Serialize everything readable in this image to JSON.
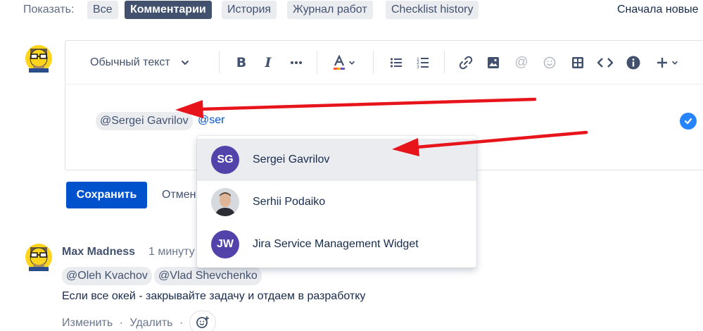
{
  "filter_bar": {
    "label": "Показать:",
    "tabs": [
      {
        "label": "Все",
        "active": false
      },
      {
        "label": "Комментарии",
        "active": true
      },
      {
        "label": "История",
        "active": false
      },
      {
        "label": "Журнал работ",
        "active": false
      },
      {
        "label": "Checklist history",
        "active": false
      }
    ],
    "sort": "Сначала новые"
  },
  "editor": {
    "text_style": "Обычный текст",
    "toolbar_icons": [
      "bold-icon",
      "italic-icon",
      "more-icon",
      "text-color-icon",
      "bullet-list-icon",
      "numbered-list-icon",
      "link-icon",
      "image-icon",
      "mention-icon",
      "emoji-icon",
      "table-icon",
      "code-icon",
      "info-icon",
      "insert-plus-icon"
    ],
    "mention_chip": "@Sergei Gavrilov",
    "mention_query": "@ser"
  },
  "buttons": {
    "save": "Сохранить",
    "cancel": "Отмен"
  },
  "mention_dropdown": {
    "items": [
      {
        "initials": "SG",
        "name": "Sergei Gavrilov",
        "selected": true,
        "avatar_color": "#5243aa"
      },
      {
        "initials": "",
        "name": "Serhii Podaiko",
        "selected": false,
        "avatar_color": "#8a8f98"
      },
      {
        "initials": "JW",
        "name": "Jira Service Management Widget",
        "selected": false,
        "avatar_color": "#5243aa"
      }
    ]
  },
  "comment": {
    "author": "Max Madness",
    "time": "1 минуту",
    "mentions": [
      "@Oleh Kvachov",
      "@Vlad Shevchenko"
    ],
    "text": "Если все окей - закрывайте задачу и отдаем в разработку",
    "actions": {
      "edit": "Изменить",
      "separator": "·",
      "delete": "Удалить"
    }
  },
  "colors": {
    "primary": "#0052cc",
    "active_tab": "#42526e",
    "annotation_arrow": "#e8141b"
  }
}
